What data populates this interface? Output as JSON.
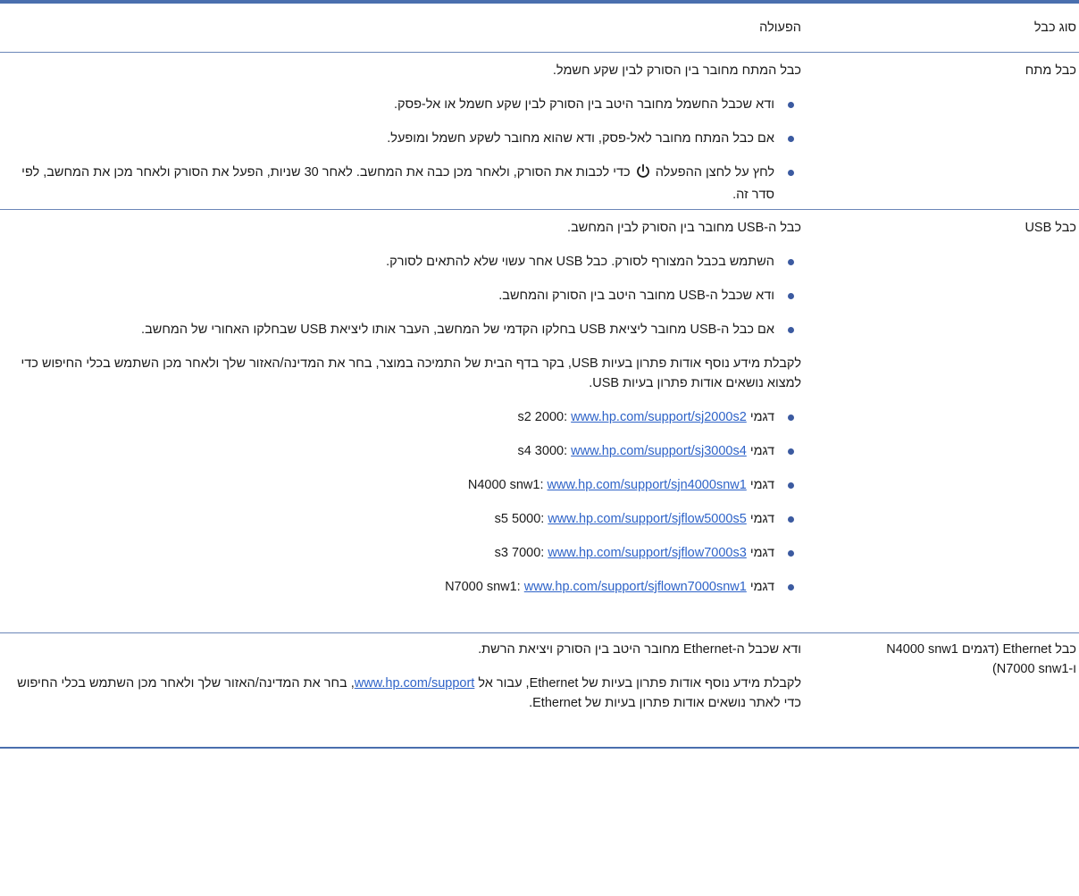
{
  "header": {
    "col_type": "סוג כבל",
    "col_action": "הפעולה"
  },
  "rows": {
    "power": {
      "type": "כבל מתח",
      "intro": "כבל המתח מחובר בין הסורק לבין שקע חשמל.",
      "bullets": [
        "ודא שכבל החשמל מחובר היטב בין הסורק לבין שקע חשמל או אל-פסק.",
        "אם כבל המתח מחובר לאל-פסק, ודא שהוא מחובר לשקע חשמל ומופעל."
      ],
      "power_bullet_before": "לחץ על לחצן ההפעלה",
      "power_bullet_after": "כדי לכבות את הסורק, ולאחר מכן כבה את המחשב. לאחר 30 שניות, הפעל את הסורק ולאחר מכן את המחשב, לפי סדר זה.",
      "power_icon": "power-icon"
    },
    "usb": {
      "type": "כבל USB",
      "intro": "כבל ה-USB מחובר בין הסורק לבין המחשב.",
      "bullets": [
        "השתמש בכבל המצורף לסורק. כבל USB אחר עשוי שלא להתאים לסורק.",
        "ודא שכבל ה-USB מחובר היטב בין הסורק והמחשב.",
        "אם כבל ה-USB מחובר ליציאת USB בחלקו הקדמי של המחשב, העבר אותו ליציאת USB שבחלקו האחורי של המחשב."
      ],
      "more_info": "לקבלת מידע נוסף אודות פתרון בעיות USB, בקר בדף הבית של התמיכה במוצר, בחר את המדינה/האזור שלך ולאחר מכן השתמש בכלי החיפוש כדי למצוא נושאים אודות פתרון בעיות USB.",
      "models": [
        {
          "label": "דגמי s2 2000:",
          "url": "www.hp.com/support/sj2000s2"
        },
        {
          "label": "דגמי s4 3000:",
          "url": "www.hp.com/support/sj3000s4"
        },
        {
          "label": "דגמי N4000 snw1:",
          "url": "www.hp.com/support/sjn4000snw1"
        },
        {
          "label": "דגמי s5 5000:",
          "url": "www.hp.com/support/sjflow5000s5"
        },
        {
          "label": "דגמי s3 7000:",
          "url": "www.hp.com/support/sjflow7000s3"
        },
        {
          "label": "דגמי N7000 snw1:",
          "url": "www.hp.com/support/sjflown7000snw1"
        }
      ]
    },
    "ethernet": {
      "type_line1": "כבל Ethernet (דגמים N4000 snw1",
      "type_line2": "ו-N7000 snw1)",
      "intro": "ודא שכבל ה-Ethernet מחובר היטב בין הסורק ויציאת הרשת.",
      "more_before": "לקבלת מידע נוסף אודות פתרון בעיות של Ethernet, עבור אל",
      "more_link": "www.hp.com/support",
      "more_after": ", בחר את המדינה/האזור שלך ולאחר מכן השתמש בכלי החיפוש כדי לאתר נושאים אודות פתרון בעיות של Ethernet."
    }
  },
  "colors": {
    "rule": "#4a6fae",
    "link": "#2e63c8",
    "bullet": "#3b5aa0"
  }
}
